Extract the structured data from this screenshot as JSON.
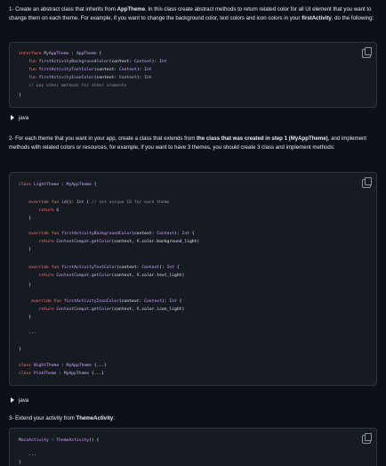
{
  "step1": {
    "prefix": "1- Create an abstract class that inherits from ",
    "bold1": "AppTheme",
    "mid": ". In this class create abstract methods to return related color for all UI element that you want to change them on each theme. For example, if you want to change the background color, text colors and icon colors in your ",
    "bold2": "firstActivity",
    "suffix": ", do the following:"
  },
  "code1": [
    "interface MyAppTheme : AppTheme {",
    "    fun firstActivityBackgroundColor(context: Context): Int",
    "    fun firstActivityTextColor(context: Context): Int",
    "    fun firstActivityIconColor(context: Context): Int",
    "    // any other methods for other elements",
    "}"
  ],
  "toggle1": "java",
  "step2": {
    "prefix": "2- For each theme that you want in your app, create a class that extends from ",
    "bold1": "the class that was created in step 1 (MyAppTheme)",
    "suffix": ", and implement methods with related colors or resources, for example, if you want to have 3 themes, you should create 3 class and implement methods:"
  },
  "code2": [
    "class LightTheme : MyAppTheme {",
    "",
    "    override fun id(): Int { // set unique ID for each theme",
    "        return 0",
    "    }",
    "",
    "    override fun firstActivityBackgroundColor(context: Context): Int {",
    "        return ContextCompat.getColor(context, R.color.background_light)",
    "    }",
    "",
    "    override fun firstActivityTextColor(context: Context): Int {",
    "        return ContextCompat.getColor(context, R.color.text_light)",
    "    }",
    "",
    "     override fun firstActivityIconColor(context: Context): Int {",
    "        return ContextCompat.getColor(context, R.color.icon_light)",
    "    }",
    "",
    "    ...",
    "",
    "}",
    "",
    "class NightTheme : MyAppTheme {...}",
    "class PinkTheme : MyAppTheme {...}"
  ],
  "toggle2": "java",
  "step3": {
    "prefix": "3- Extend your activity from ",
    "bold1": "ThemeActivity",
    "suffix": ":"
  },
  "code3": [
    "MainActivity : ThemeActivity() {",
    "",
    "    ...",
    "}"
  ],
  "colors": {
    "background": "#0d1117",
    "code_background": "#161b22",
    "keyword": "#ff7b72",
    "type": "#d2a8ff",
    "comment": "#8b949e"
  }
}
